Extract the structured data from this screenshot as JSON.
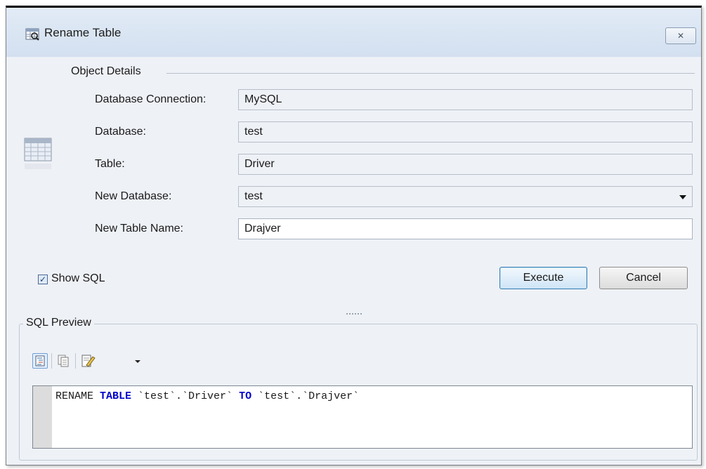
{
  "window": {
    "title": "Rename Table",
    "close_label": "✕"
  },
  "object_details": {
    "section_title": "Object Details",
    "fields": {
      "connection": {
        "label": "Database Connection:",
        "value": "MySQL"
      },
      "database": {
        "label": "Database:",
        "value": "test"
      },
      "table": {
        "label": "Table:",
        "value": "Driver"
      },
      "new_database": {
        "label": "New Database:",
        "value": "test"
      },
      "new_table_name": {
        "label": "New Table Name:",
        "value": "Drajver"
      }
    }
  },
  "show_sql": {
    "label": "Show SQL",
    "checked": true
  },
  "buttons": {
    "execute": "Execute",
    "cancel": "Cancel"
  },
  "sql_preview": {
    "section_title": "SQL Preview",
    "sql": {
      "p1": "RENAME ",
      "k1": "TABLE",
      "p2": " `test`.`Driver` ",
      "k2": "TO",
      "p3": " `test`.`Drajver`"
    }
  },
  "colors": {
    "keyword": "#0000cc",
    "dialog_bg": "#eef1f6",
    "titlebar": "#d3e0f0",
    "execute_border": "#3c7fb1"
  }
}
